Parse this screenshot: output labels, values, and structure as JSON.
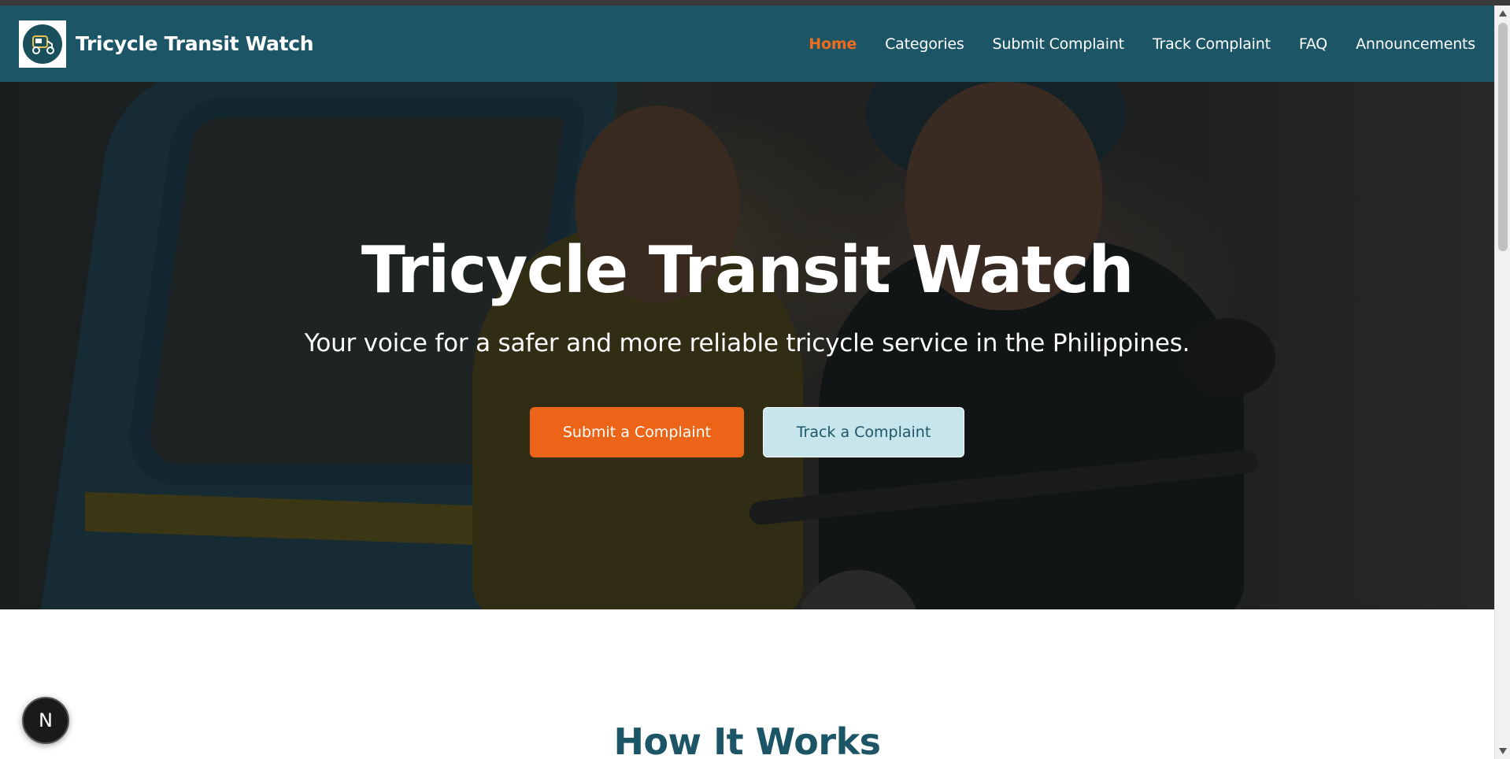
{
  "nav": {
    "brand": "Tricycle Transit Watch",
    "logo_icon": "tricycle-logo-icon",
    "links": [
      {
        "label": "Home",
        "active": true
      },
      {
        "label": "Categories",
        "active": false
      },
      {
        "label": "Submit Complaint",
        "active": false
      },
      {
        "label": "Track Complaint",
        "active": false
      },
      {
        "label": "FAQ",
        "active": false
      },
      {
        "label": "Announcements",
        "active": false
      }
    ]
  },
  "hero": {
    "title": "Tricycle Transit Watch",
    "subtitle": "Your voice for a safer and more reliable tricycle service in the Philippines.",
    "primary_button": "Submit a Complaint",
    "secondary_button": "Track a Complaint"
  },
  "section": {
    "title": "How It Works"
  },
  "fab": {
    "label": "N"
  },
  "colors": {
    "navbar": "#1c5565",
    "accent": "#ec6417",
    "secondary_button": "#c6e6ec",
    "heading": "#1c5565"
  }
}
